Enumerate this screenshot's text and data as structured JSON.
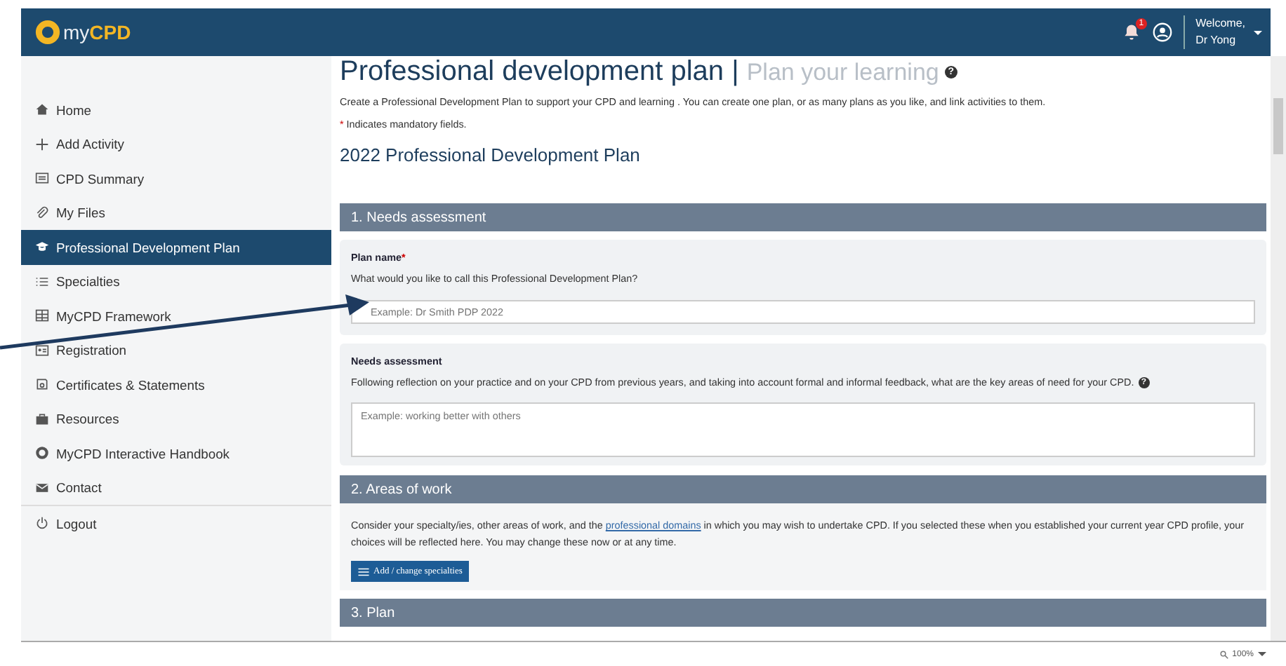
{
  "header": {
    "logo_prefix": "my",
    "logo_brand": "CPD",
    "notification_count": "1",
    "welcome": "Welcome,",
    "user": "Dr Yong"
  },
  "sidebar": {
    "items": [
      {
        "label": "Home",
        "selected": false
      },
      {
        "label": "Add Activity",
        "selected": false
      },
      {
        "label": "CPD Summary",
        "selected": false
      },
      {
        "label": "My Files",
        "selected": false
      },
      {
        "label": "Professional Development Plan",
        "selected": true
      },
      {
        "label": "Specialties",
        "selected": false
      },
      {
        "label": "MyCPD Framework",
        "selected": false
      },
      {
        "label": "Registration",
        "selected": false
      },
      {
        "label": "Certificates & Statements",
        "selected": false
      },
      {
        "label": "Resources",
        "selected": false
      },
      {
        "label": "MyCPD Interactive Handbook",
        "selected": false
      },
      {
        "label": "Contact",
        "selected": false
      }
    ],
    "logout": "Logout"
  },
  "page": {
    "title": "Professional development plan",
    "separator": "|",
    "subtitle": "Plan your learning",
    "help_icon": "?",
    "intro": "Create a Professional Development Plan to support your CPD and learning . You can create one plan, or as many plans as you like, and link activities to them.",
    "mandatory_mark": "*",
    "mandatory_note": "Indicates mandatory fields.",
    "plan_title": "2022 Professional Development Plan",
    "sections": [
      {
        "kind": "needs",
        "heading": "1. Needs assessment",
        "plan_name_label": "Plan name",
        "plan_name_required": "*",
        "plan_name_question": "What would you like to call this Professional Development Plan?",
        "plan_name_placeholder": "Example: Dr Smith PDP 2022",
        "needs_label": "Needs assessment",
        "needs_question": "Following reflection on your practice and on your CPD from previous years, and taking into account formal and informal feedback, what are the key areas of need for your CPD.",
        "needs_help_icon": "?",
        "needs_placeholder": "Example: working better with others"
      },
      {
        "kind": "areas",
        "heading": "2. Areas of work",
        "text_before": "Consider your specialty/ies, other areas of work, and the",
        "link": "professional domains",
        "text_after": "in which you may wish to undertake CPD. If you selected these when you established your current year CPD profile, your choices will be reflected here. You may change these now or at any time.",
        "button": "Add / change specialties"
      },
      {
        "kind": "plan",
        "heading": "3. Plan"
      }
    ]
  },
  "status_bar": {
    "zoom": "100%"
  }
}
